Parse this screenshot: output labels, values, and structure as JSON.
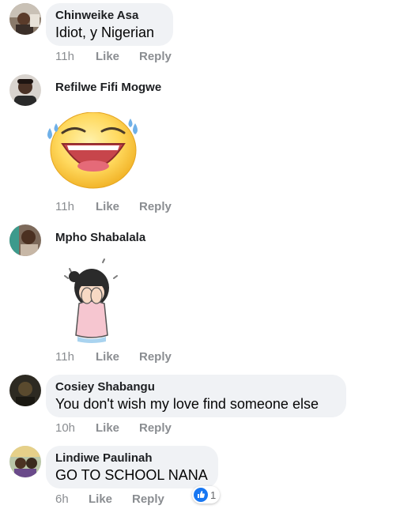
{
  "comments": [
    {
      "author": "Chinweike Asa",
      "text": "Idiot, y Nigerian",
      "time": "11h"
    },
    {
      "author": "Refilwe Fifi Mogwe",
      "time": "11h",
      "sticker": "laughing-tears-emoji"
    },
    {
      "author": "Mpho Shabalala",
      "time": "11h",
      "sticker": "crying-girl-sticker"
    },
    {
      "author": "Cosiey Shabangu",
      "text": "You don't wish my love find someone else",
      "time": "10h"
    },
    {
      "author": "Lindiwe Paulinah",
      "text": "GO TO SCHOOL NANA",
      "time": "6h",
      "reaction": {
        "icon": "like-icon",
        "count": "1"
      }
    }
  ],
  "actions": {
    "like": "Like",
    "reply": "Reply"
  },
  "colors": {
    "bubble": "#f0f2f5",
    "meta": "#8a8d91",
    "like_blue": "#1877f2"
  }
}
